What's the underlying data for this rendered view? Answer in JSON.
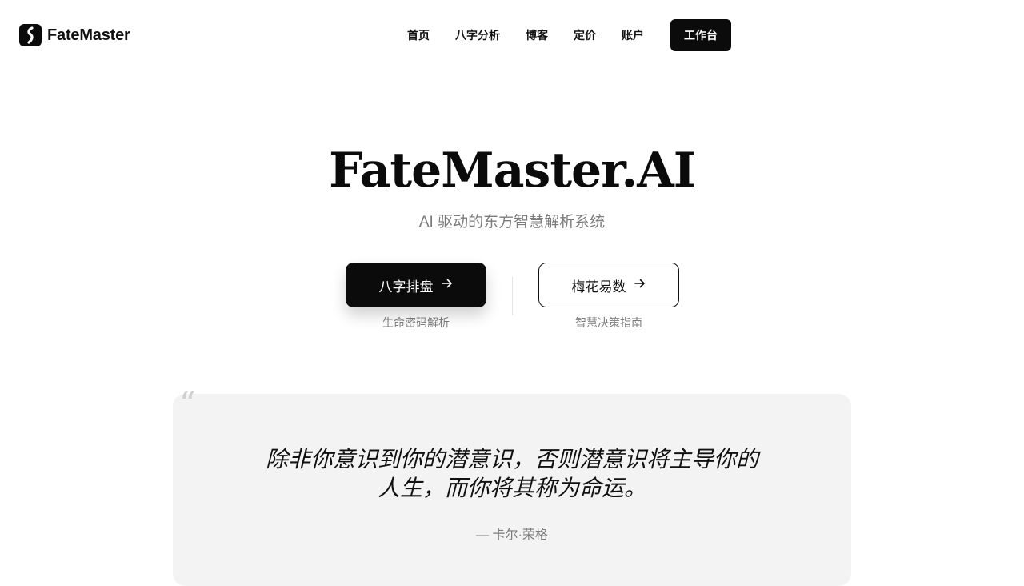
{
  "header": {
    "logo_text": "FateMaster",
    "nav": [
      "首页",
      "八字分析",
      "博客",
      "定价",
      "账户"
    ],
    "cta_label": "工作台"
  },
  "hero": {
    "title": "FateMaster.AI",
    "subtitle": "AI 驱动的东方智慧解析系统",
    "primary_button": {
      "label": "八字排盘",
      "caption": "生命密码解析"
    },
    "secondary_button": {
      "label": "梅花易数",
      "caption": "智慧决策指南"
    }
  },
  "quote": {
    "mark": "“",
    "text": "除非你意识到你的潜意识，否则潜意识将主导你的人生，而你将其称为命运。",
    "author": "— 卡尔·荣格"
  },
  "icons": {
    "logo": "logo-icon",
    "arrow": "arrow-right-icon"
  },
  "colors": {
    "primary": "#0b0b0b",
    "muted_text": "#7b7b7b",
    "card_bg": "#f3f3f3"
  }
}
